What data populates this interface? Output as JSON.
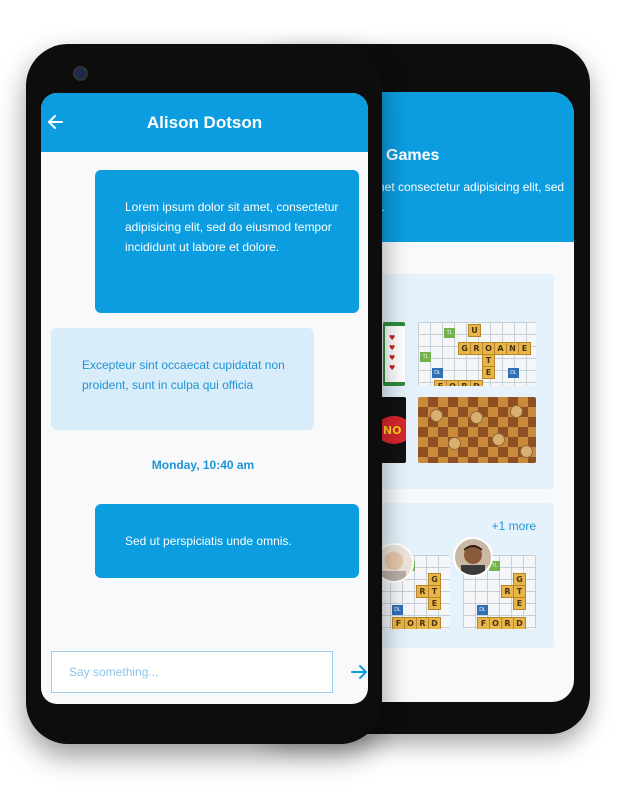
{
  "back_screen": {
    "title": "Games",
    "description": "amet consectetur adipisicing elit, sed do.",
    "more_label": "+1 more",
    "scrabble_words": [
      "GROANE",
      "UTE",
      "FORD"
    ],
    "uno_label": "UNO"
  },
  "chat": {
    "title": "Alison Dotson",
    "messages": [
      {
        "direction": "outgoing",
        "text": "Lorem ipsum dolor sit amet, consectetur adipisicing elit, sed do eiusmod tempor incididunt ut labore et dolore."
      },
      {
        "direction": "incoming",
        "text": "Excepteur sint occaecat cupidatat non proident, sunt in culpa qui officia"
      },
      {
        "direction": "outgoing",
        "text": "Sed ut perspiciatis unde omnis."
      }
    ],
    "timestamp": "Monday, 10:40 am",
    "input_placeholder": "Say something..."
  },
  "icons": {
    "back": "arrow-left-icon",
    "send": "arrow-right-icon"
  },
  "colors": {
    "accent": "#0c9de0",
    "incoming_bubble": "#d9ecf9",
    "link_text": "#1e94d6"
  }
}
